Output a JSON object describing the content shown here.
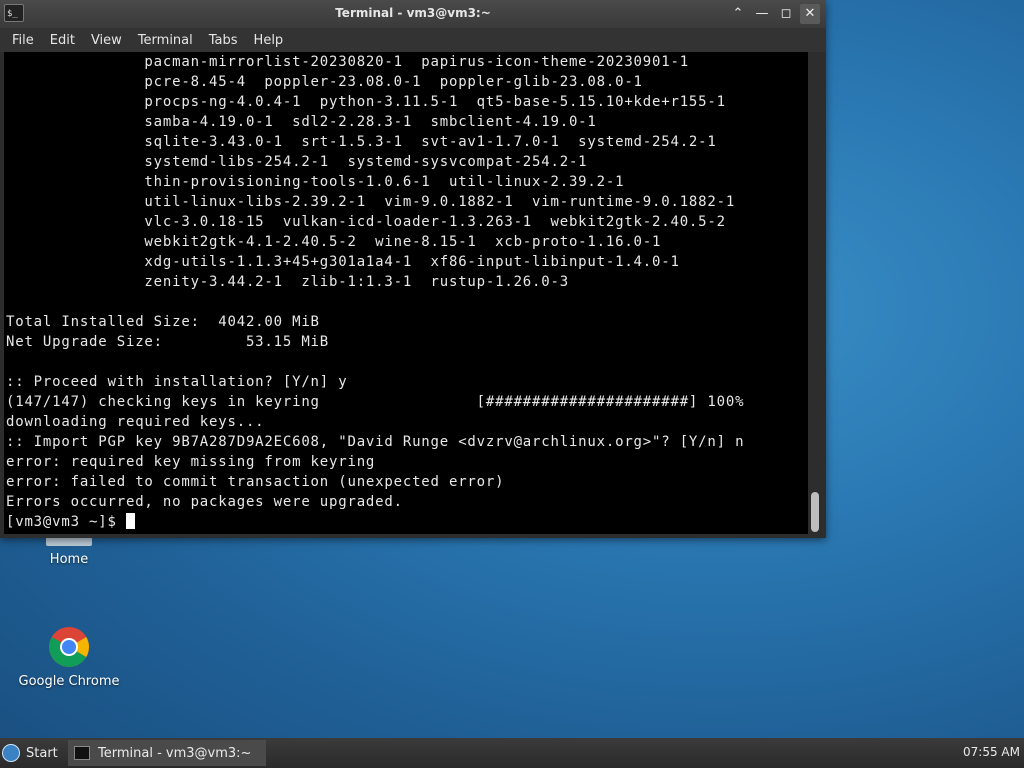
{
  "window": {
    "title": "Terminal - vm3@vm3:~",
    "app_icon_glyph": "$_",
    "controls": {
      "minimize": "—",
      "maximize": "◻",
      "close": "✕",
      "rollup": "⌃"
    }
  },
  "menu": [
    "File",
    "Edit",
    "View",
    "Terminal",
    "Tabs",
    "Help"
  ],
  "terminal": {
    "lines": [
      "               pacman-mirrorlist-20230820-1  papirus-icon-theme-20230901-1",
      "               pcre-8.45-4  poppler-23.08.0-1  poppler-glib-23.08.0-1",
      "               procps-ng-4.0.4-1  python-3.11.5-1  qt5-base-5.15.10+kde+r155-1",
      "               samba-4.19.0-1  sdl2-2.28.3-1  smbclient-4.19.0-1",
      "               sqlite-3.43.0-1  srt-1.5.3-1  svt-av1-1.7.0-1  systemd-254.2-1",
      "               systemd-libs-254.2-1  systemd-sysvcompat-254.2-1",
      "               thin-provisioning-tools-1.0.6-1  util-linux-2.39.2-1",
      "               util-linux-libs-2.39.2-1  vim-9.0.1882-1  vim-runtime-9.0.1882-1",
      "               vlc-3.0.18-15  vulkan-icd-loader-1.3.263-1  webkit2gtk-2.40.5-2",
      "               webkit2gtk-4.1-2.40.5-2  wine-8.15-1  xcb-proto-1.16.0-1",
      "               xdg-utils-1.1.3+45+g301a1a4-1  xf86-input-libinput-1.4.0-1",
      "               zenity-3.44.2-1  zlib-1:1.3-1  rustup-1.26.0-3",
      "",
      "Total Installed Size:  4042.00 MiB",
      "Net Upgrade Size:         53.15 MiB",
      "",
      ":: Proceed with installation? [Y/n] y",
      "(147/147) checking keys in keyring                 [######################] 100%",
      "downloading required keys...",
      ":: Import PGP key 9B7A287D9A2EC608, \"David Runge <dvzrv@archlinux.org>\"? [Y/n] n",
      "error: required key missing from keyring",
      "error: failed to commit transaction (unexpected error)",
      "Errors occurred, no packages were upgraded."
    ],
    "prompt": "[vm3@vm3 ~]$ "
  },
  "desktop": {
    "icons": [
      {
        "label": "Home",
        "icon": "folder-icon"
      },
      {
        "label": "Google Chrome",
        "icon": "chrome-icon"
      }
    ]
  },
  "taskbar": {
    "start_label": "Start",
    "task_label": "Terminal - vm3@vm3:~",
    "clock": "07:55 AM"
  }
}
